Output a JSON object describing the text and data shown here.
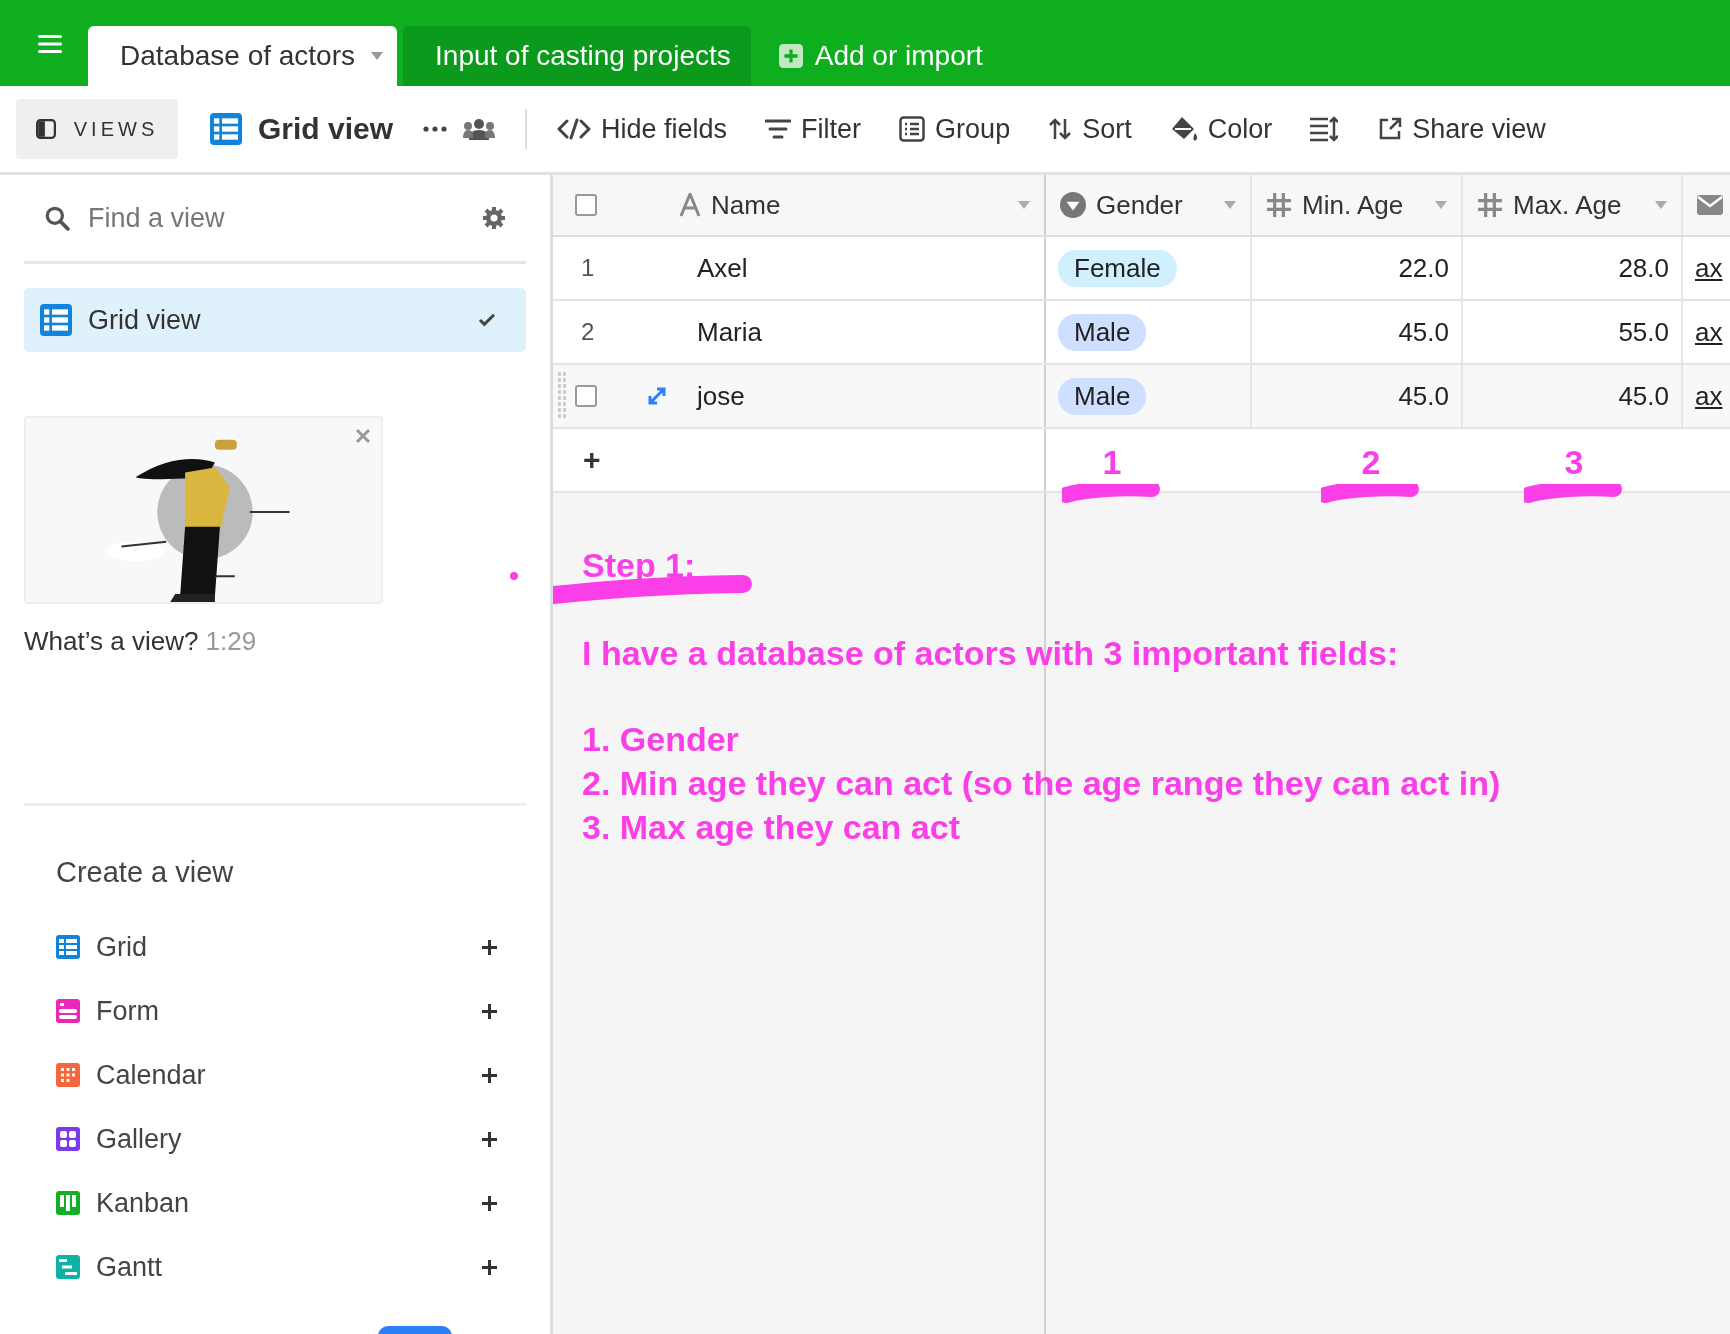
{
  "tabs": [
    {
      "label": "Database of actors",
      "selected": true
    },
    {
      "label": "Input of casting projects",
      "selected": false
    }
  ],
  "add_tab": "Add or import",
  "toolbar": {
    "views_label": "VIEWS",
    "view_name": "Grid view",
    "items": [
      {
        "label": "Hide fields"
      },
      {
        "label": "Filter"
      },
      {
        "label": "Group"
      },
      {
        "label": "Sort"
      },
      {
        "label": "Color"
      },
      {
        "label": "Share view"
      }
    ]
  },
  "sidebar": {
    "search": {
      "placeholder": "Find a view"
    },
    "views": [
      {
        "label": "Grid view",
        "selected": true
      }
    ],
    "video": {
      "kind": "picture",
      "caption": "What’s a view?",
      "duration": "1:29"
    },
    "create": {
      "title": "Create a view",
      "items": [
        {
          "label": "Grid",
          "kind": "grid",
          "color": "#1283da"
        },
        {
          "label": "Form",
          "kind": "form",
          "color": "#e929ba"
        },
        {
          "label": "Calendar",
          "kind": "calendar",
          "color": "#f7653b"
        },
        {
          "label": "Gallery",
          "kind": "gallery",
          "color": "#7c39ed"
        },
        {
          "label": "Kanban",
          "kind": "kanban",
          "color": "#11af22"
        },
        {
          "label": "Gantt",
          "kind": "gantt",
          "color": "#0eb3a5"
        }
      ]
    }
  },
  "table": {
    "columns": [
      {
        "name": "Name",
        "kind": "text"
      },
      {
        "name": "Gender",
        "kind": "select"
      },
      {
        "name": "Min. Age",
        "kind": "number"
      },
      {
        "name": "Max. Age",
        "kind": "number"
      }
    ],
    "all_checked": false,
    "rows": [
      {
        "number": "1",
        "hovered": false,
        "name": "Axel",
        "gender": {
          "label": "Female",
          "color": "#d0f0fd"
        },
        "min_age": "22.0",
        "max_age": "28.0",
        "column_5": "ax"
      },
      {
        "number": "2",
        "hovered": false,
        "name": "Maria",
        "gender": {
          "label": "Male",
          "color": "#cfdfff"
        },
        "min_age": "45.0",
        "max_age": "55.0",
        "column_5": "ax"
      },
      {
        "hovered": true,
        "checked": false,
        "name": "jose",
        "gender": {
          "label": "Male",
          "color": "#cfdfff"
        },
        "min_age": "45.0",
        "max_age": "45.0",
        "column_5": "ax"
      }
    ],
    "add_row": "+"
  },
  "annotations": {
    "column_marks": [
      "1",
      "2",
      "3"
    ],
    "step_title": "Step 1:",
    "intro": "I have a database of actors with 3 important fields:",
    "list": [
      "1. Gender",
      "2. Min age they can act (so the age range they can act in)",
      "3. Max age they can act"
    ]
  }
}
